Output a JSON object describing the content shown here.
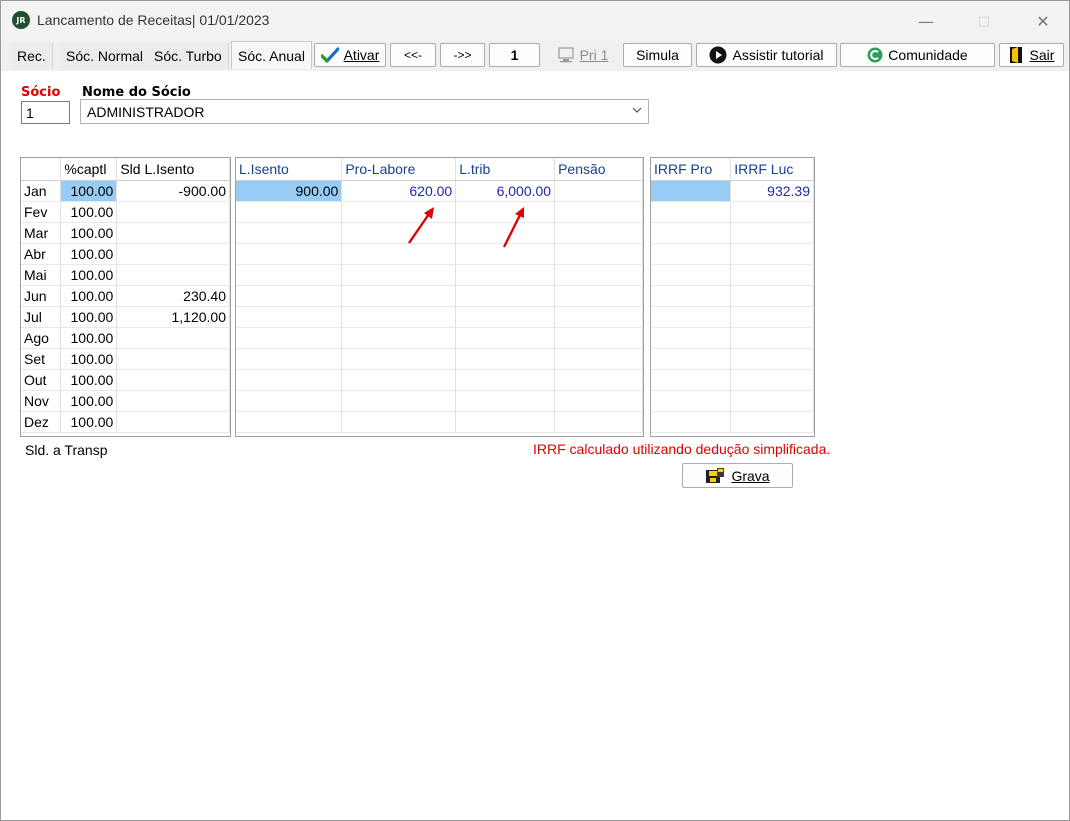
{
  "window": {
    "app_icon_text": "JR",
    "title": "Lancamento de Receitas|  01/01/2023"
  },
  "tabs": [
    {
      "label": "Rec."
    },
    {
      "label": "Sóc. Normal"
    },
    {
      "label": "Sóc. Turbo"
    },
    {
      "label": "Sóc. Anual"
    }
  ],
  "toolbar": {
    "ativar": "Ativar",
    "prev": "<<-",
    "next": "->>",
    "page": "1",
    "pri": "Pri 1",
    "simula": "Simula",
    "tutorial": "Assistir tutorial",
    "comunidade": "Comunidade",
    "sair": "Sair"
  },
  "socio": {
    "socio_label": "Sócio",
    "nome_label": "Nome do Sócio",
    "socio_value": "1",
    "nome_value": "ADMINISTRADOR"
  },
  "grid1": {
    "headers": [
      "",
      "%captl",
      "Sld L.Isento"
    ],
    "rows": [
      [
        "Jan",
        "100.00",
        "-900.00"
      ],
      [
        "Fev",
        "100.00",
        ""
      ],
      [
        "Mar",
        "100.00",
        ""
      ],
      [
        "Abr",
        "100.00",
        ""
      ],
      [
        "Mai",
        "100.00",
        ""
      ],
      [
        "Jun",
        "100.00",
        "230.40"
      ],
      [
        "Jul",
        "100.00",
        "1,120.00"
      ],
      [
        "Ago",
        "100.00",
        ""
      ],
      [
        "Set",
        "100.00",
        ""
      ],
      [
        "Out",
        "100.00",
        ""
      ],
      [
        "Nov",
        "100.00",
        ""
      ],
      [
        "Dez",
        "100.00",
        ""
      ]
    ]
  },
  "grid2": {
    "headers": [
      "L.Isento",
      "Pro-Labore",
      "L.trib",
      "Pensão"
    ],
    "rows": [
      [
        "900.00",
        "620.00",
        "6,000.00",
        ""
      ],
      [
        "",
        "",
        "",
        ""
      ],
      [
        "",
        "",
        "",
        ""
      ],
      [
        "",
        "",
        "",
        ""
      ],
      [
        "",
        "",
        "",
        ""
      ],
      [
        "",
        "",
        "",
        ""
      ],
      [
        "",
        "",
        "",
        ""
      ],
      [
        "",
        "",
        "",
        ""
      ],
      [
        "",
        "",
        "",
        ""
      ],
      [
        "",
        "",
        "",
        ""
      ],
      [
        "",
        "",
        "",
        ""
      ],
      [
        "",
        "",
        "",
        ""
      ]
    ]
  },
  "grid3": {
    "headers": [
      "IRRF Pro",
      "IRRF Luc"
    ],
    "rows": [
      [
        "",
        "932.39"
      ],
      [
        "",
        ""
      ],
      [
        "",
        ""
      ],
      [
        "",
        ""
      ],
      [
        "",
        ""
      ],
      [
        "",
        ""
      ],
      [
        "",
        ""
      ],
      [
        "",
        ""
      ],
      [
        "",
        ""
      ],
      [
        "",
        ""
      ],
      [
        "",
        ""
      ],
      [
        "",
        ""
      ]
    ]
  },
  "footer": {
    "sld_transp": "Sld. a Transp",
    "warning": "IRRF calculado utilizando dedução simplificada.",
    "grava": "Grava"
  },
  "colors": {
    "warning": "#e00000",
    "selection": "#99ccf5",
    "value_blue": "#1f2aa8",
    "annotation_arrow": "#e00000"
  }
}
